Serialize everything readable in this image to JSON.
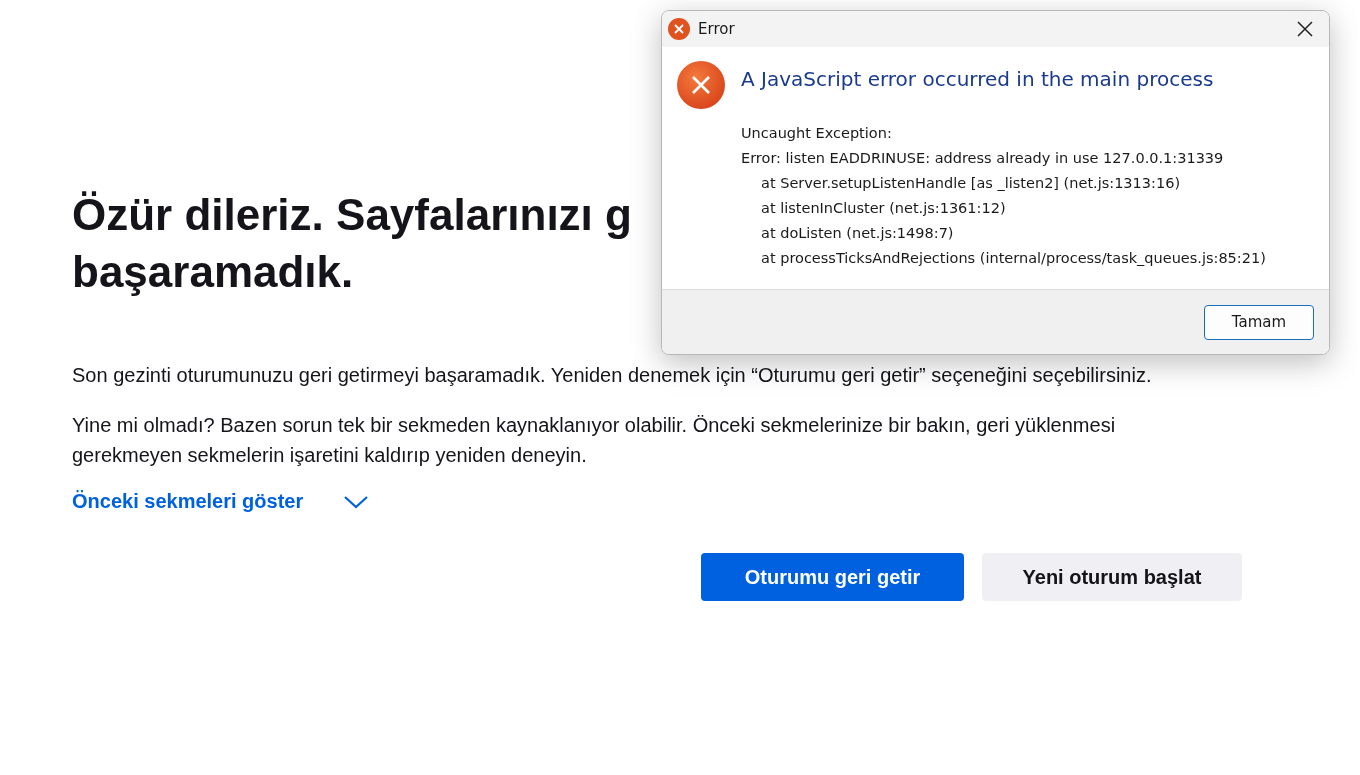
{
  "page": {
    "heading_lines": [
      "Özür dileriz. Sayfalarınızı g",
      "başaramadık."
    ],
    "paragraphs": [
      "Son gezinti oturumunuzu geri getirmeyi başaramadık. Yeniden denemek için “Oturumu geri getir” seçeneğini seçebilirsiniz.",
      "Yine mi olmadı? Bazen sorun tek bir sekmeden kaynaklanıyor olabilir. Önceki sekmelerinize bir bakın, geri yüklenmesi gerekmeyen sekmelerin işaretini kaldırıp yeniden deneyin."
    ],
    "show_tabs": {
      "label": "Önceki sekmeleri göster",
      "expanded": false
    },
    "buttons": [
      {
        "label": "Oturumu geri getir",
        "kind": "primary"
      },
      {
        "label": "Yeni oturum başlat",
        "kind": "secondary"
      }
    ]
  },
  "dialog": {
    "title": "Error",
    "heading": "A JavaScript error occurred in the main process",
    "message_lines": [
      {
        "text": "Uncaught Exception:",
        "kind": "plain"
      },
      {
        "text": "Error: listen EADDRINUSE: address already in use 127.0.0.1:31339",
        "kind": "plain"
      },
      {
        "text": "at Server.setupListenHandle [as _listen2] (net.js:1313:16)",
        "kind": "frame"
      },
      {
        "text": "at listenInCluster (net.js:1361:12)",
        "kind": "frame"
      },
      {
        "text": "at doListen (net.js:1498:7)",
        "kind": "frame"
      },
      {
        "text": "at processTicksAndRejections (internal/process/task_queues.js:85:21)",
        "kind": "frame"
      }
    ],
    "button": "Tamam"
  }
}
